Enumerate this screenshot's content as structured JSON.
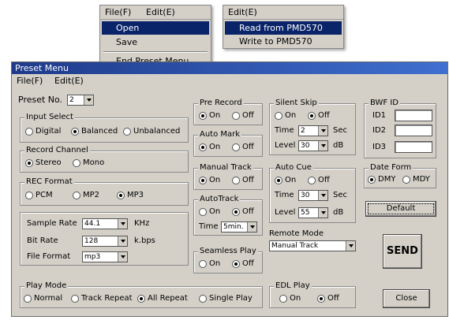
{
  "menu1": {
    "bar": [
      "File(F)",
      "Edit(E)"
    ],
    "items": [
      "Open",
      "Save",
      "End Preset Menu"
    ]
  },
  "menu2": {
    "bar": "Edit(E)",
    "items": [
      "Read from PMD570",
      "Write to PMD570"
    ]
  },
  "window": {
    "title": "Preset Menu",
    "menubar": [
      "File(F)",
      "Edit(E)"
    ]
  },
  "preset": {
    "label": "Preset No.",
    "value": "2"
  },
  "input_select": {
    "title": "Input Select",
    "options": [
      "Digital",
      "Balanced",
      "Unbalanced"
    ],
    "selected": "Balanced"
  },
  "record_channel": {
    "title": "Record Channel",
    "options": [
      "Stereo",
      "Mono"
    ],
    "selected": "Stereo"
  },
  "rec_format": {
    "title": "REC Format",
    "options": [
      "PCM",
      "MP2",
      "MP3"
    ],
    "selected": "MP3"
  },
  "sample_rate": {
    "label": "Sample Rate",
    "value": "44.1",
    "unit": "KHz"
  },
  "bit_rate": {
    "label": "Bit Rate",
    "value": "128",
    "unit": "k.bps"
  },
  "file_format": {
    "label": "File Format",
    "value": "mp3"
  },
  "pre_record": {
    "title": "Pre Record",
    "options": [
      "On",
      "Off"
    ],
    "selected": "On"
  },
  "auto_mark": {
    "title": "Auto Mark",
    "options": [
      "On",
      "Off"
    ],
    "selected": "On"
  },
  "manual_track": {
    "title": "Manual Track",
    "options": [
      "On",
      "Off"
    ],
    "selected": "On"
  },
  "auto_track": {
    "title": "AutoTrack",
    "options": [
      "On",
      "Off"
    ],
    "selected": "Off",
    "time_label": "Time",
    "time_value": "5min."
  },
  "seamless_play": {
    "title": "Seamless Play",
    "options": [
      "On",
      "Off"
    ],
    "selected": "Off"
  },
  "silent_skip": {
    "title": "Silent Skip",
    "options": [
      "On",
      "Off"
    ],
    "selected": "Off",
    "time_label": "Time",
    "time_value": "2",
    "time_unit": "Sec",
    "level_label": "Level",
    "level_value": "30",
    "level_unit": "dB"
  },
  "auto_cue": {
    "title": "Auto Cue",
    "options": [
      "On",
      "Off"
    ],
    "selected": "On",
    "time_label": "Time",
    "time_value": "30",
    "time_unit": "Sec",
    "level_label": "Level",
    "level_value": "55",
    "level_unit": "dB"
  },
  "remote_mode": {
    "label": "Remote Mode",
    "value": "Manual Track"
  },
  "bwf_id": {
    "title": "BWF ID",
    "labels": [
      "ID1",
      "ID2",
      "ID3"
    ]
  },
  "date_form": {
    "title": "Date Form",
    "options": [
      "DMY",
      "MDY"
    ],
    "selected": "DMY"
  },
  "buttons": {
    "default": "Default",
    "send": "SEND",
    "close": "Close"
  },
  "play_mode": {
    "title": "Play Mode",
    "options": [
      "Normal",
      "Track Repeat",
      "All Repeat",
      "Single Play"
    ],
    "selected": "All Repeat"
  },
  "edl_play": {
    "title": "EDL Play",
    "options": [
      "On",
      "Off"
    ],
    "selected": "Off"
  }
}
